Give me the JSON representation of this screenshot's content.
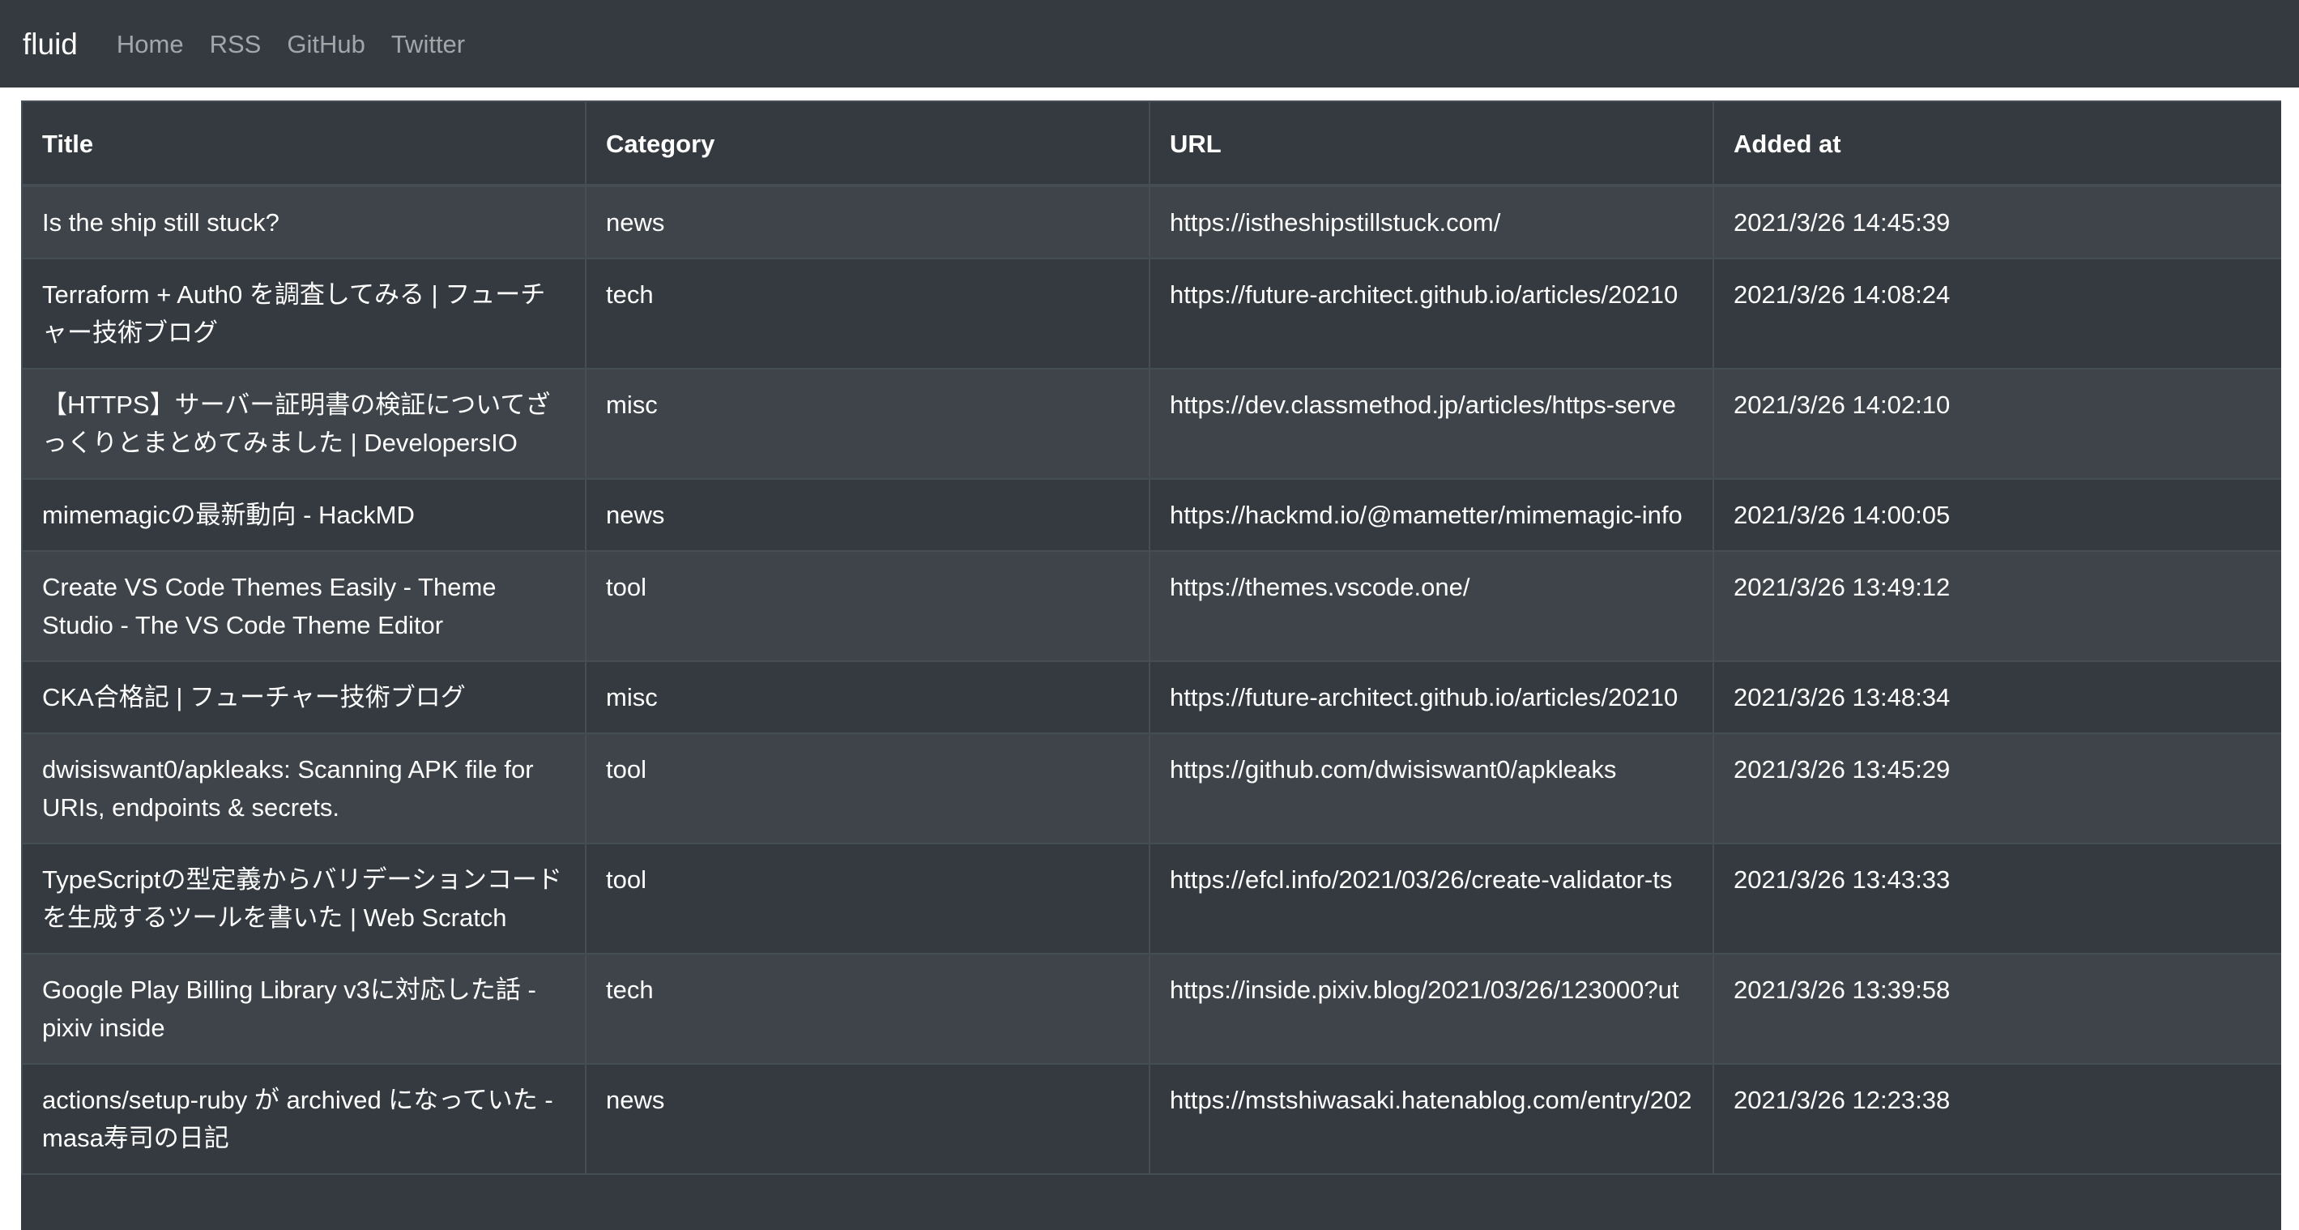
{
  "navbar": {
    "brand": "fluid",
    "links": [
      "Home",
      "RSS",
      "GitHub",
      "Twitter"
    ]
  },
  "table": {
    "headers": [
      "Title",
      "Category",
      "URL",
      "Added at"
    ],
    "rows": [
      {
        "title": "Is the ship still stuck?",
        "category": "news",
        "url": "https://istheshipstillstuck.com/",
        "added": "2021/3/26 14:45:39"
      },
      {
        "title": "Terraform + Auth0 を調査してみる | フューチャー技術ブログ",
        "category": "tech",
        "url": "https://future-architect.github.io/articles/20210",
        "added": "2021/3/26 14:08:24"
      },
      {
        "title": "【HTTPS】サーバー証明書の検証についてざっくりとまとめてみました | DevelopersIO",
        "category": "misc",
        "url": "https://dev.classmethod.jp/articles/https-serve",
        "added": "2021/3/26 14:02:10"
      },
      {
        "title": "mimemagicの最新動向 - HackMD",
        "category": "news",
        "url": "https://hackmd.io/@mametter/mimemagic-info",
        "added": "2021/3/26 14:00:05"
      },
      {
        "title": "Create VS Code Themes Easily - Theme Studio - The VS Code Theme Editor",
        "category": "tool",
        "url": "https://themes.vscode.one/",
        "added": "2021/3/26 13:49:12"
      },
      {
        "title": "CKA合格記 | フューチャー技術ブログ",
        "category": "misc",
        "url": "https://future-architect.github.io/articles/20210",
        "added": "2021/3/26 13:48:34"
      },
      {
        "title": "dwisiswant0/apkleaks: Scanning APK file for URIs, endpoints & secrets.",
        "category": "tool",
        "url": "https://github.com/dwisiswant0/apkleaks",
        "added": "2021/3/26 13:45:29"
      },
      {
        "title": "TypeScriptの型定義からバリデーションコードを生成するツールを書いた | Web Scratch",
        "category": "tool",
        "url": "https://efcl.info/2021/03/26/create-validator-ts",
        "added": "2021/3/26 13:43:33"
      },
      {
        "title": "Google Play Billing Library v3に対応した話 - pixiv inside",
        "category": "tech",
        "url": "https://inside.pixiv.blog/2021/03/26/123000?ut",
        "added": "2021/3/26 13:39:58"
      },
      {
        "title": "actions/setup-ruby が archived になっていた - masa寿司の日記",
        "category": "news",
        "url": "https://mstshiwasaki.hatenablog.com/entry/202",
        "added": "2021/3/26 12:23:38"
      }
    ]
  }
}
